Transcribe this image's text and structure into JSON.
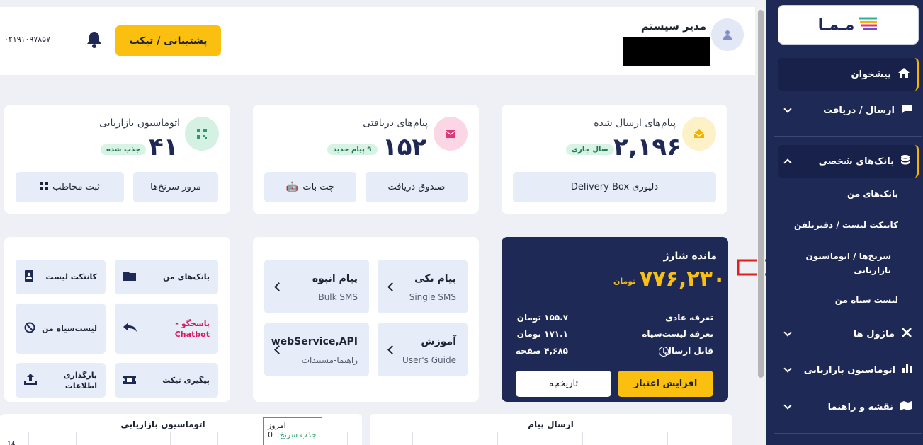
{
  "header": {
    "user_name": "مدیر سیستم",
    "support_label": "پشتیبانی / تیکت",
    "phone": "۰۲۱۹۱۰۹۷۸۵۷"
  },
  "stats": [
    {
      "title": "پیام‌های ارسال شده",
      "value": "۲,۱۹۶",
      "badge": "سال جاری",
      "icon": "envelope-open-icon",
      "buttons": [
        "دلیوری Delivery Box"
      ]
    },
    {
      "title": "پیام‌های دریافتی",
      "value": "۱۵۲",
      "badge": "۹ پیام جدید",
      "icon": "envelope-icon",
      "buttons": [
        "صندوق دریافت",
        "چت بات"
      ]
    },
    {
      "title": "اتوماسیون بازاریابی",
      "value": "۴۱",
      "badge": "جذب شده",
      "icon": "qrcode-icon",
      "buttons": [
        "مرور سرنخ‌ها",
        "ثبت مخاطب"
      ]
    }
  ],
  "balance": {
    "title": "مانده شارژ",
    "amount": "۷۷۶,۲۳۰",
    "currency": "تومان",
    "rows": [
      {
        "label": "تعرفه عادی",
        "value": "۱۵۵.۷ تومان"
      },
      {
        "label": "تعرفه لیست‌سیاه",
        "value": "۱۷۱.۱ تومان"
      },
      {
        "label": "قابل ارسال",
        "value": "۴,۶۸۵ صفحه"
      }
    ],
    "increase_label": "افزایش اعتبار",
    "history_label": "تاریخچه"
  },
  "services": [
    {
      "title": "پیام تکی",
      "subtitle": "Single SMS"
    },
    {
      "title": "پیام انبوه",
      "subtitle": "Bulk SMS"
    },
    {
      "title": "آموزش",
      "subtitle": "User's Guide"
    },
    {
      "title": "webService,API",
      "subtitle": "راهنما-مستندات"
    }
  ],
  "quick_links": [
    {
      "label": "بانک‌های من"
    },
    {
      "label": "کانتکت لیست"
    },
    {
      "label": "پاسخگو - Chatbot"
    },
    {
      "label": "لیست‌سیاه من"
    },
    {
      "label": "پیگیری تیکت"
    },
    {
      "label": "بارگذاری اطلاعات"
    }
  ],
  "charts": {
    "send_title": "ارسال پیام",
    "auto_title": "اتوماسیون بازاریابی",
    "today_label": "امروز",
    "leads_label": "جذب سرنخ:",
    "leads_value": "0",
    "axis_value": "14"
  },
  "sidebar": {
    "logo_text": "مـمـا",
    "items": [
      {
        "label": "پیشخوان",
        "icon": "home-icon"
      },
      {
        "label": "ارسال / دریافت",
        "icon": "chat-icon"
      },
      {
        "label": "بانک‌های شخصی",
        "icon": "database-icon"
      },
      {
        "label": "ماژول ها",
        "icon": "tools-icon"
      },
      {
        "label": "اتوماسیون بازاریابی",
        "icon": "bar-chart-icon"
      },
      {
        "label": "نقشه و راهنما",
        "icon": "map-icon"
      }
    ],
    "sub_items": [
      {
        "label": "بانک‌های من"
      },
      {
        "label": "کانتکت لیست / دفترتلفن"
      },
      {
        "label": "سرنخ‌ها / اتوماسیون بازاریابی"
      },
      {
        "label": "لیست سیاه من"
      }
    ]
  },
  "colors": {
    "accent": "#fbbf10",
    "navy": "#1e2a55",
    "red_arrow": "#e0201c"
  }
}
